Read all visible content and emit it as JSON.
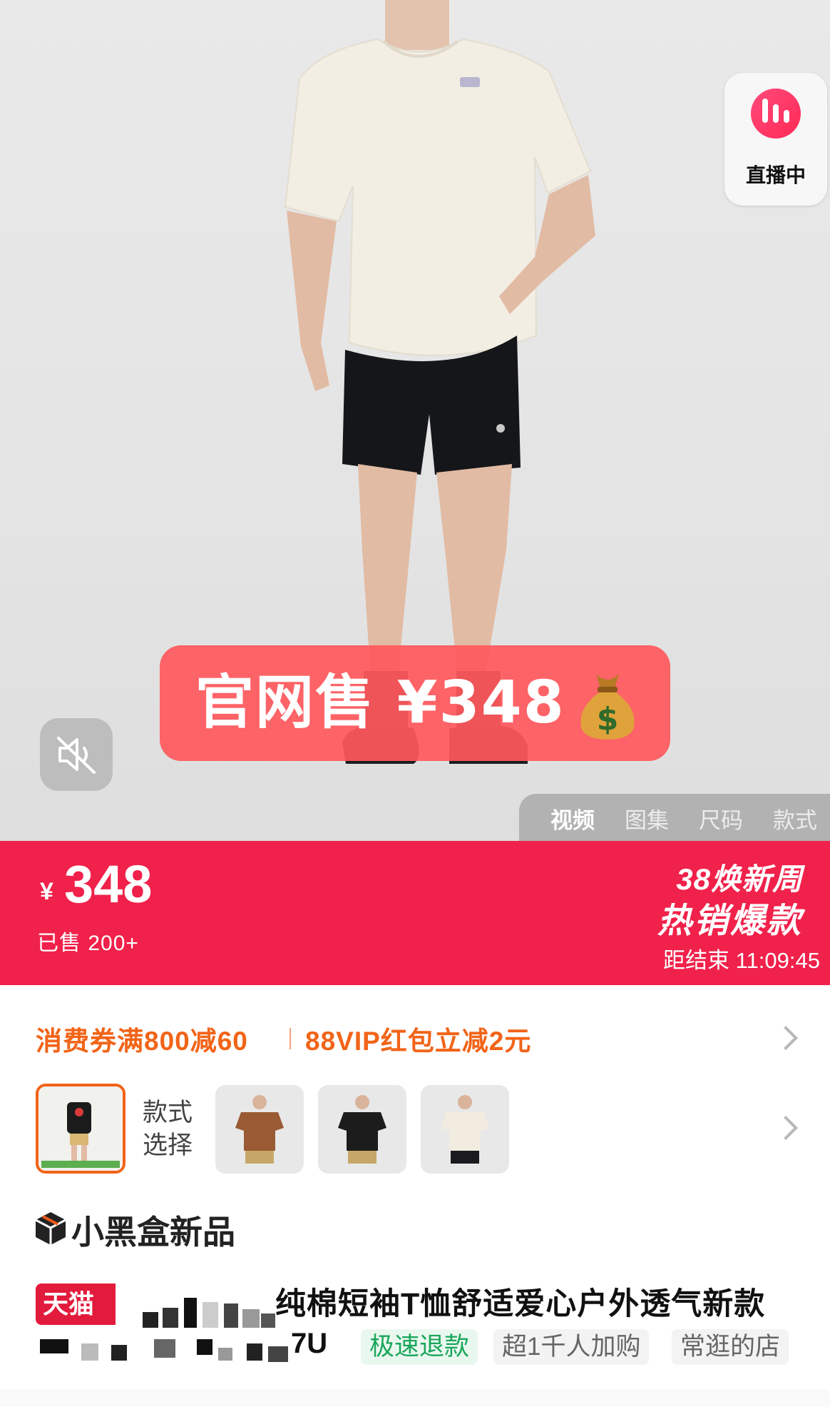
{
  "hero": {
    "live_badge_label": "直播中",
    "price_banner_text": "官网售 ¥348",
    "media_tabs": [
      "视频",
      "图集",
      "尺码",
      "款式"
    ],
    "active_media_tab": "视频"
  },
  "price_bar": {
    "currency": "¥",
    "price": "348",
    "sold": "已售 200+",
    "promo_line1": "38焕新周",
    "promo_line2": "热销爆款",
    "countdown": "距结束 11:09:45",
    "background_color": "#f0214a"
  },
  "coupon": {
    "text1": "消费券满800减60",
    "text2": "88VIP红包立减2元",
    "accent_color": "#f26418"
  },
  "style_selector": {
    "label": "款式\n选择",
    "thumbnails": [
      "black-tshirt-back",
      "brown-tshirt",
      "black-tshirt",
      "cream-tshirt"
    ],
    "selected_index": 0
  },
  "brand": {
    "title": "小黑盒新品"
  },
  "product": {
    "store_tag": "天猫",
    "title_visible": "纯棉短袖T恤舒适爱心户外透气新款",
    "model_suffix": "7U",
    "tags": [
      "极速退款",
      "超1千人加购",
      "常逛的店"
    ]
  }
}
